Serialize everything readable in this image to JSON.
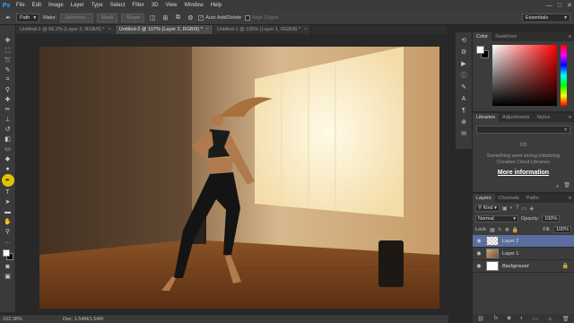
{
  "app": {
    "logo": "Ps"
  },
  "menu": [
    "File",
    "Edit",
    "Image",
    "Layer",
    "Type",
    "Select",
    "Filter",
    "3D",
    "View",
    "Window",
    "Help"
  ],
  "window_controls": [
    "—",
    "□",
    "✕"
  ],
  "options": {
    "mode_value": "Path",
    "make_label": "Make:",
    "selection_btn": "Selection...",
    "mask_btn": "Mask",
    "shape_btn": "Shape",
    "auto_add_label": "Auto Add/Delete",
    "auto_add_checked": "✓",
    "align_edges_label": "Align Edges",
    "workspace": "Essentials"
  },
  "tabs": [
    {
      "label": "Untitled-1 @ 66.2% (Layer 2, RGB/8) *",
      "active": false
    },
    {
      "label": "Untitled-2 @ 107% (Layer 2, RGB/8) *",
      "active": true
    },
    {
      "label": "Untitled-1 @ 100% (Layer 1, RGB/8) *",
      "active": false
    }
  ],
  "tab_close": "×",
  "status": {
    "zoom": "102.38%",
    "doc": "Doc: 1.54M/1.54M"
  },
  "panels": {
    "color_tabs": [
      "Color",
      "Swatches"
    ],
    "libraries_tabs": [
      "Libraries",
      "Adjustments",
      "Styles"
    ],
    "libraries_message_1": "Something went wrong initializing",
    "libraries_message_2": "Creative Cloud Libraries",
    "libraries_link": "More information",
    "layers_tabs": [
      "Layers",
      "Channels",
      "Paths"
    ],
    "kind_label": "Kind",
    "blend_mode": "Normal",
    "opacity_label": "Opacity:",
    "opacity_value": "100%",
    "lock_label": "Lock:",
    "fill_label": "Fill:",
    "fill_value": "100%",
    "menu_glyph": "≡"
  },
  "layers": [
    {
      "name": "Layer 2",
      "selected": true,
      "thumb": "transparent"
    },
    {
      "name": "Layer 1",
      "selected": false,
      "thumb": "photo"
    },
    {
      "name": "Background",
      "selected": false,
      "thumb": "white",
      "locked": true
    }
  ],
  "icons": {
    "eye": "◉",
    "lock": "🔒"
  }
}
